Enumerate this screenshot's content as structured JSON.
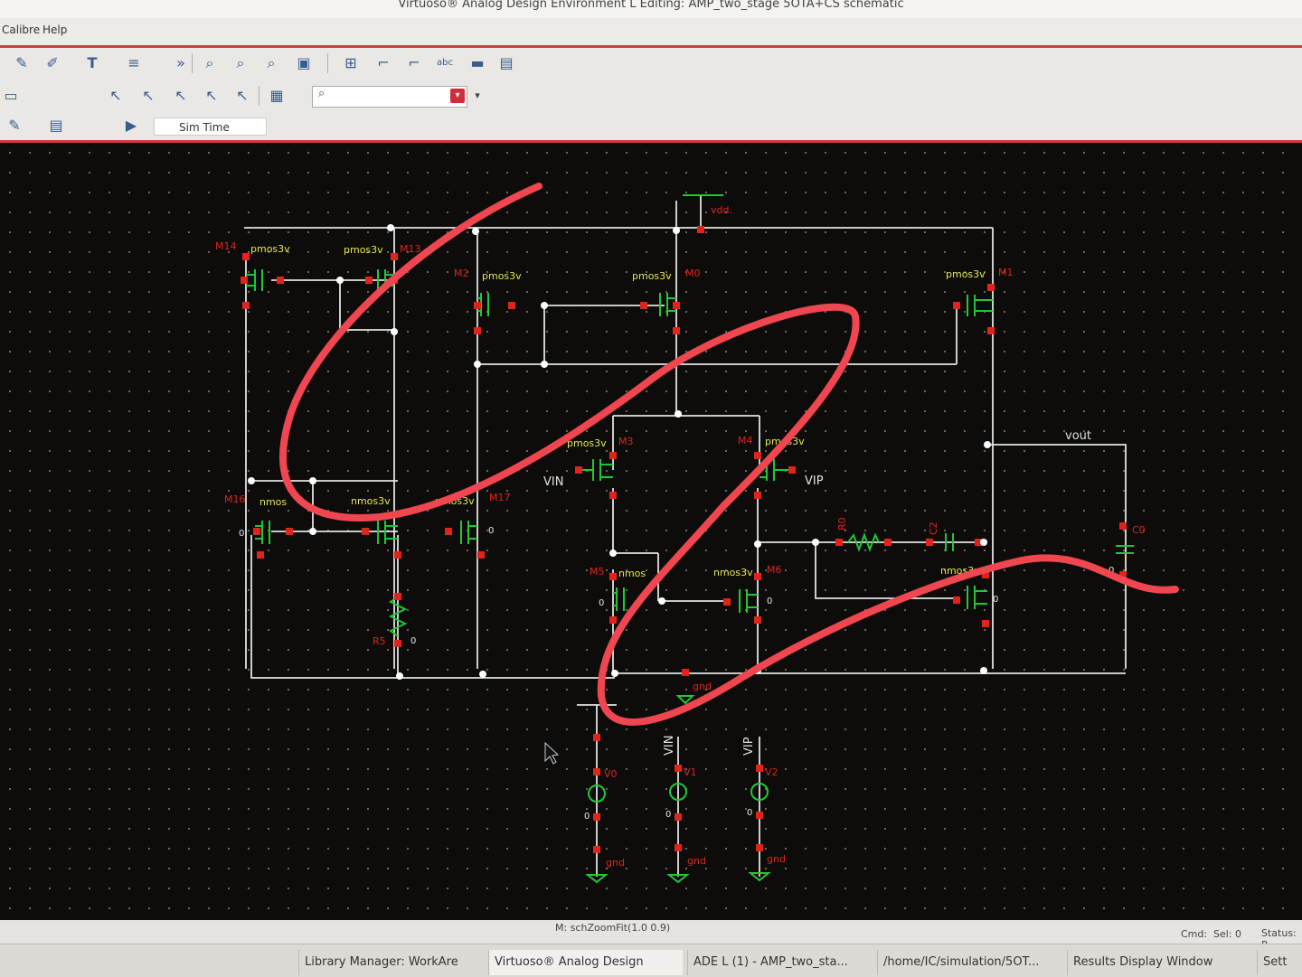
{
  "window": {
    "title": "Virtuoso® Analog Design Environment L Editing: AMP_two_stage 5OTA+CS schematic"
  },
  "menubar": {
    "items": [
      "Calibre",
      "Help"
    ]
  },
  "toolbar": {
    "simtime_label": "Sim Time"
  },
  "schematic": {
    "pins": {
      "vdd": "vdd.",
      "vout": "vout",
      "vin": "VIN",
      "vip": "VIP",
      "gnd": "gnd"
    },
    "devices": {
      "m14": "M14",
      "m13": "M13",
      "m2": "M2",
      "m0": "M0",
      "m1": "M1",
      "m3": "M3",
      "m4": "M4",
      "m16": "M16",
      "m17": "M17",
      "m5": "M5",
      "m6": "M6",
      "r5": "R5",
      "r0": "R0",
      "c0": "C0",
      "v0": "V0",
      "v1": "V1",
      "v2": "V2"
    },
    "cell_types": {
      "pmos": "pmos3v",
      "nmos": "nmos3v",
      "nmos_partial": "nmos",
      "cap": "C2"
    },
    "zero": "0"
  },
  "status": {
    "command": "M: schZoomFit(1.0 0.9)",
    "cmd": "Cmd:",
    "sel": "Sel: 0",
    "status": "Status: R"
  },
  "taskbar": {
    "items": [
      "Library Manager: WorkAre",
      "Virtuoso® Analog Design",
      "ADE L (1) - AMP_two_sta...",
      "/home/IC/simulation/5OT...",
      "Results Display Window",
      "Sett"
    ]
  },
  "colors": {
    "wire": "#e2e2e2",
    "device": "#20c838",
    "pin": "#e0241b",
    "label": "#e6e84a",
    "annotation": "#f04650",
    "canvas": "#0d0c0b"
  }
}
